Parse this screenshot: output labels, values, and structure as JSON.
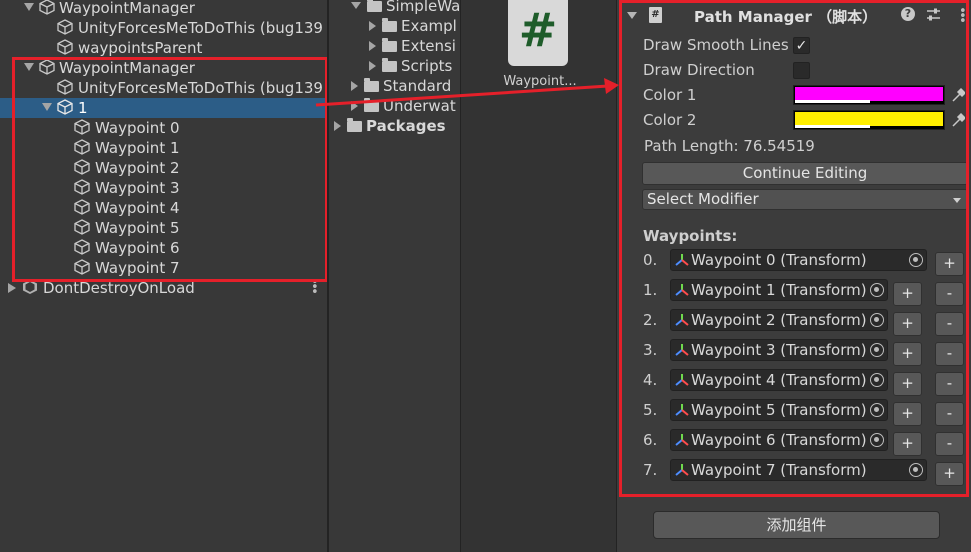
{
  "hierarchy": {
    "rows": [
      {
        "label": "WaypointManager"
      },
      {
        "label": "UnityForcesMeToDoThis (bug139"
      },
      {
        "label": "waypointsParent"
      },
      {
        "label": "WaypointManager"
      },
      {
        "label": "UnityForcesMeToDoThis (bug139"
      },
      {
        "label": "1"
      },
      {
        "label": "Waypoint 0"
      },
      {
        "label": "Waypoint 1"
      },
      {
        "label": "Waypoint 2"
      },
      {
        "label": "Waypoint 3"
      },
      {
        "label": "Waypoint 4"
      },
      {
        "label": "Waypoint 5"
      },
      {
        "label": "Waypoint 6"
      },
      {
        "label": "Waypoint 7"
      },
      {
        "label": "DontDestroyOnLoad"
      }
    ]
  },
  "project": {
    "tree": [
      {
        "label": "SimpleWa"
      },
      {
        "label": "Exampl"
      },
      {
        "label": "Extensi"
      },
      {
        "label": "Scripts"
      },
      {
        "label": "Standard"
      },
      {
        "label": "Underwat"
      },
      {
        "label": "Packages"
      }
    ],
    "asset": {
      "label": "Waypoint...",
      "icon": "#"
    }
  },
  "inspector": {
    "component_title": "Path Manager （脚本）",
    "draw_smooth_lines_label": "Draw Smooth Lines",
    "draw_smooth_lines_checked": "✓",
    "draw_direction_label": "Draw Direction",
    "color1_label": "Color 1",
    "color1": "#ff00ff",
    "color2_label": "Color 2",
    "color2": "#ffee00",
    "path_length": "Path Length: 76.54519",
    "continue_editing": "Continue Editing",
    "select_modifier": "Select Modifier",
    "waypoints_header": "Waypoints:",
    "waypoints": [
      {
        "index": "0.",
        "value": "Waypoint 0 (Transform)"
      },
      {
        "index": "1.",
        "value": "Waypoint 1 (Transform)"
      },
      {
        "index": "2.",
        "value": "Waypoint 2 (Transform)"
      },
      {
        "index": "3.",
        "value": "Waypoint 3 (Transform)"
      },
      {
        "index": "4.",
        "value": "Waypoint 4 (Transform)"
      },
      {
        "index": "5.",
        "value": "Waypoint 5 (Transform)"
      },
      {
        "index": "6.",
        "value": "Waypoint 6 (Transform)"
      },
      {
        "index": "7.",
        "value": "Waypoint 7 (Transform)"
      }
    ],
    "plus": "+",
    "minus": "-",
    "add_component": "添加组件"
  },
  "colors": {
    "selection": "#2c5d87",
    "highlight_red": "#e5202a"
  }
}
